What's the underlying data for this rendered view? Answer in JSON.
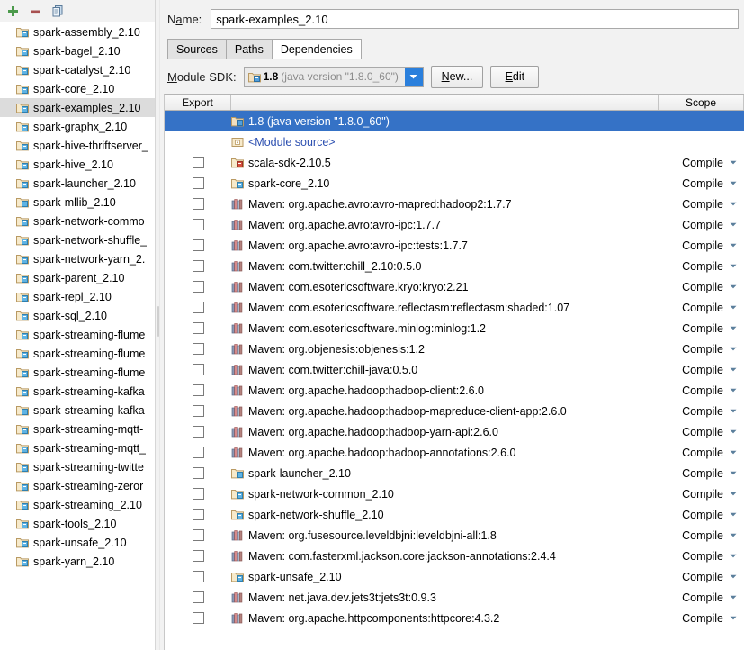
{
  "left_toolbar": {
    "buttons": [
      {
        "name": "add-button",
        "icon": "plus-icon",
        "tooltip": "Add"
      },
      {
        "name": "remove-button",
        "icon": "minus-icon",
        "tooltip": "Remove"
      },
      {
        "name": "copy-button",
        "icon": "copy-icon",
        "tooltip": "Copy"
      }
    ]
  },
  "modules": {
    "selected": "spark-examples_2.10",
    "items": [
      {
        "label": "spark-assembly_2.10",
        "icon": "module-icon"
      },
      {
        "label": "spark-bagel_2.10",
        "icon": "module-icon"
      },
      {
        "label": "spark-catalyst_2.10",
        "icon": "module-icon"
      },
      {
        "label": "spark-core_2.10",
        "icon": "module-icon"
      },
      {
        "label": "spark-examples_2.10",
        "icon": "module-icon",
        "selected": true
      },
      {
        "label": "spark-graphx_2.10",
        "icon": "module-icon"
      },
      {
        "label": "spark-hive-thriftserver_",
        "icon": "module-icon",
        "truncated": true
      },
      {
        "label": "spark-hive_2.10",
        "icon": "module-icon"
      },
      {
        "label": "spark-launcher_2.10",
        "icon": "module-icon"
      },
      {
        "label": "spark-mllib_2.10",
        "icon": "module-icon"
      },
      {
        "label": "spark-network-commo",
        "icon": "module-icon",
        "truncated": true
      },
      {
        "label": "spark-network-shuffle_",
        "icon": "module-icon",
        "truncated": true
      },
      {
        "label": "spark-network-yarn_2.",
        "icon": "module-icon",
        "truncated": true
      },
      {
        "label": "spark-parent_2.10",
        "icon": "module-icon"
      },
      {
        "label": "spark-repl_2.10",
        "icon": "module-icon"
      },
      {
        "label": "spark-sql_2.10",
        "icon": "module-icon"
      },
      {
        "label": "spark-streaming-flume",
        "icon": "module-icon",
        "truncated": true
      },
      {
        "label": "spark-streaming-flume",
        "icon": "module-icon",
        "truncated": true
      },
      {
        "label": "spark-streaming-flume",
        "icon": "module-icon",
        "truncated": true
      },
      {
        "label": "spark-streaming-kafka",
        "icon": "module-icon",
        "truncated": true
      },
      {
        "label": "spark-streaming-kafka",
        "icon": "module-icon",
        "truncated": true
      },
      {
        "label": "spark-streaming-mqtt-",
        "icon": "module-icon",
        "truncated": true
      },
      {
        "label": "spark-streaming-mqtt_",
        "icon": "module-icon",
        "truncated": true
      },
      {
        "label": "spark-streaming-twitte",
        "icon": "module-icon",
        "truncated": true
      },
      {
        "label": "spark-streaming-zeror",
        "icon": "module-icon",
        "truncated": true
      },
      {
        "label": "spark-streaming_2.10",
        "icon": "module-icon"
      },
      {
        "label": "spark-tools_2.10",
        "icon": "module-icon"
      },
      {
        "label": "spark-unsafe_2.10",
        "icon": "module-icon"
      },
      {
        "label": "spark-yarn_2.10",
        "icon": "module-icon"
      }
    ]
  },
  "name_field": {
    "label_pre": "N",
    "label_mnemonic": "a",
    "label_post": "me:",
    "value": "spark-examples_2.10",
    "placeholder": ""
  },
  "tabs": [
    {
      "label": "Sources",
      "active": false
    },
    {
      "label": "Paths",
      "active": false
    },
    {
      "label": "Dependencies",
      "active": true
    }
  ],
  "sdk_row": {
    "label_pre": "",
    "label_mnemonic": "M",
    "label_post": "odule SDK:",
    "combo": {
      "icon": "sdk-icon",
      "version": "1.8",
      "description": "(java version \"1.8.0_60\")",
      "arrow_icon": "chevron-down-icon",
      "arrow_color": "#2a7fdc"
    },
    "new_button": {
      "label_pre": "",
      "label_mnemonic": "N",
      "label_post": "ew..."
    },
    "edit_button": {
      "label_pre": "",
      "label_mnemonic": "E",
      "label_post": "dit"
    }
  },
  "table": {
    "headers": {
      "export": "Export",
      "middle": "",
      "scope": "Scope"
    },
    "selection_color": "#3572c6",
    "scope_default": "Compile",
    "rows": [
      {
        "label": "1.8 (java version \"1.8.0_60\")",
        "icon": "sdk-icon",
        "checkbox": false,
        "scope": "",
        "selected": true,
        "kind": "sdk"
      },
      {
        "label": "<Module source>",
        "icon": "module-source-icon",
        "checkbox": false,
        "scope": "",
        "kind": "module-source"
      },
      {
        "label": "scala-sdk-2.10.5",
        "icon": "scala-sdk-icon",
        "checkbox": true,
        "checked": false,
        "scope": "Compile",
        "kind": "library"
      },
      {
        "label": "spark-core_2.10",
        "icon": "module-icon",
        "checkbox": true,
        "checked": false,
        "scope": "Compile",
        "kind": "module"
      },
      {
        "label": "Maven: org.apache.avro:avro-mapred:hadoop2:1.7.7",
        "icon": "maven-library-icon",
        "checkbox": true,
        "checked": false,
        "scope": "Compile",
        "kind": "maven"
      },
      {
        "label": "Maven: org.apache.avro:avro-ipc:1.7.7",
        "icon": "maven-library-icon",
        "checkbox": true,
        "checked": false,
        "scope": "Compile",
        "kind": "maven"
      },
      {
        "label": "Maven: org.apache.avro:avro-ipc:tests:1.7.7",
        "icon": "maven-library-icon",
        "checkbox": true,
        "checked": false,
        "scope": "Compile",
        "kind": "maven"
      },
      {
        "label": "Maven: com.twitter:chill_2.10:0.5.0",
        "icon": "maven-library-icon",
        "checkbox": true,
        "checked": false,
        "scope": "Compile",
        "kind": "maven"
      },
      {
        "label": "Maven: com.esotericsoftware.kryo:kryo:2.21",
        "icon": "maven-library-icon",
        "checkbox": true,
        "checked": false,
        "scope": "Compile",
        "kind": "maven"
      },
      {
        "label": "Maven: com.esotericsoftware.reflectasm:reflectasm:shaded:1.07",
        "icon": "maven-library-icon",
        "checkbox": true,
        "checked": false,
        "scope": "Compile",
        "kind": "maven"
      },
      {
        "label": "Maven: com.esotericsoftware.minlog:minlog:1.2",
        "icon": "maven-library-icon",
        "checkbox": true,
        "checked": false,
        "scope": "Compile",
        "kind": "maven"
      },
      {
        "label": "Maven: org.objenesis:objenesis:1.2",
        "icon": "maven-library-icon",
        "checkbox": true,
        "checked": false,
        "scope": "Compile",
        "kind": "maven"
      },
      {
        "label": "Maven: com.twitter:chill-java:0.5.0",
        "icon": "maven-library-icon",
        "checkbox": true,
        "checked": false,
        "scope": "Compile",
        "kind": "maven"
      },
      {
        "label": "Maven: org.apache.hadoop:hadoop-client:2.6.0",
        "icon": "maven-library-icon",
        "checkbox": true,
        "checked": false,
        "scope": "Compile",
        "kind": "maven"
      },
      {
        "label": "Maven: org.apache.hadoop:hadoop-mapreduce-client-app:2.6.0",
        "icon": "maven-library-icon",
        "checkbox": true,
        "checked": false,
        "scope": "Compile",
        "kind": "maven"
      },
      {
        "label": "Maven: org.apache.hadoop:hadoop-yarn-api:2.6.0",
        "icon": "maven-library-icon",
        "checkbox": true,
        "checked": false,
        "scope": "Compile",
        "kind": "maven"
      },
      {
        "label": "Maven: org.apache.hadoop:hadoop-annotations:2.6.0",
        "icon": "maven-library-icon",
        "checkbox": true,
        "checked": false,
        "scope": "Compile",
        "kind": "maven"
      },
      {
        "label": "spark-launcher_2.10",
        "icon": "module-icon",
        "checkbox": true,
        "checked": false,
        "scope": "Compile",
        "kind": "module"
      },
      {
        "label": "spark-network-common_2.10",
        "icon": "module-icon",
        "checkbox": true,
        "checked": false,
        "scope": "Compile",
        "kind": "module"
      },
      {
        "label": "spark-network-shuffle_2.10",
        "icon": "module-icon",
        "checkbox": true,
        "checked": false,
        "scope": "Compile",
        "kind": "module"
      },
      {
        "label": "Maven: org.fusesource.leveldbjni:leveldbjni-all:1.8",
        "icon": "maven-library-icon",
        "checkbox": true,
        "checked": false,
        "scope": "Compile",
        "kind": "maven"
      },
      {
        "label": "Maven: com.fasterxml.jackson.core:jackson-annotations:2.4.4",
        "icon": "maven-library-icon",
        "checkbox": true,
        "checked": false,
        "scope": "Compile",
        "kind": "maven"
      },
      {
        "label": "spark-unsafe_2.10",
        "icon": "module-icon",
        "checkbox": true,
        "checked": false,
        "scope": "Compile",
        "kind": "module"
      },
      {
        "label": "Maven: net.java.dev.jets3t:jets3t:0.9.3",
        "icon": "maven-library-icon",
        "checkbox": true,
        "checked": false,
        "scope": "Compile",
        "kind": "maven"
      },
      {
        "label": "Maven: org.apache.httpcomponents:httpcore:4.3.2",
        "icon": "maven-library-icon",
        "checkbox": true,
        "checked": false,
        "scope": "Compile",
        "kind": "maven"
      }
    ]
  }
}
